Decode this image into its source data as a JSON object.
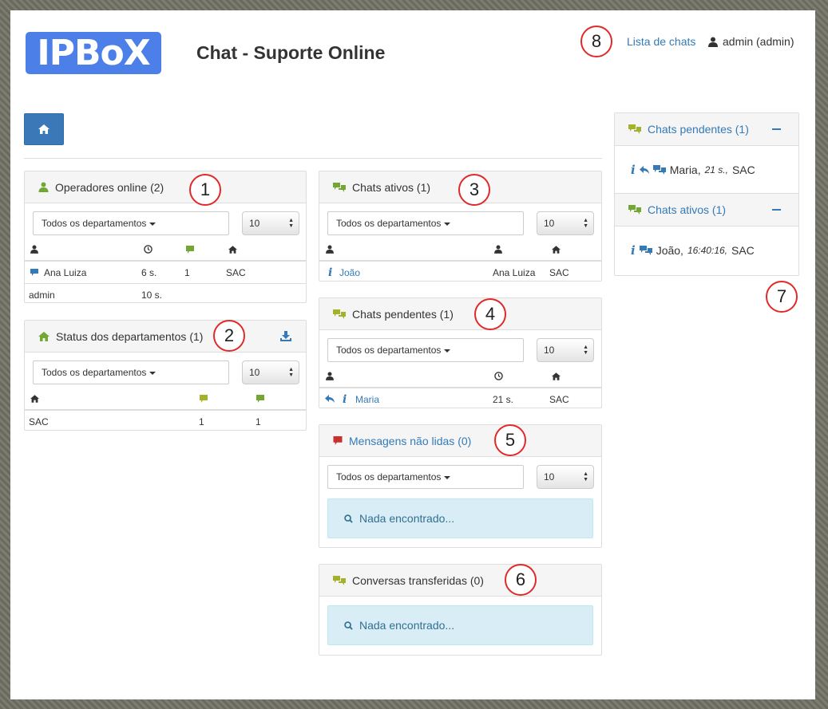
{
  "header": {
    "logo": "IPBoX",
    "title": "Chat - Suporte Online",
    "chat_list_link": "Lista de chats",
    "user": "admin (admin)"
  },
  "callouts": [
    "1",
    "2",
    "3",
    "4",
    "5",
    "6",
    "7",
    "8"
  ],
  "filter": {
    "department": "Todos os departamentos",
    "page_size": "10"
  },
  "online_operators": {
    "title": "Operadores online (2)",
    "rows": [
      {
        "name": "Ana Luiza",
        "time": "6 s.",
        "chats": "1",
        "dept": "SAC"
      },
      {
        "name": "admin",
        "time": "10 s.",
        "chats": "",
        "dept": ""
      }
    ]
  },
  "dept_status": {
    "title": "Status dos departamentos (1)",
    "rows": [
      {
        "dept": "SAC",
        "a": "1",
        "b": "1"
      }
    ]
  },
  "active_chats": {
    "title": "Chats ativos (1)",
    "rows": [
      {
        "visitor": "João",
        "operator": "Ana Luiza",
        "dept": "SAC"
      }
    ]
  },
  "pending_chats": {
    "title": "Chats pendentes (1)",
    "rows": [
      {
        "visitor": "Maria",
        "time": "21 s.",
        "dept": "SAC"
      }
    ]
  },
  "unread_messages": {
    "title": "Mensagens não lidas (0)",
    "empty": "Nada encontrado..."
  },
  "transferred": {
    "title": "Conversas transferidas (0)",
    "empty": "Nada encontrado..."
  },
  "sidebar": {
    "pending_title": "Chats pendentes (1)",
    "pending_item": {
      "name": "Maria,",
      "time": "21 s.,",
      "dept": "SAC"
    },
    "active_title": "Chats ativos (1)",
    "active_item": {
      "name": "João,",
      "time": "16:40:16,",
      "dept": "SAC"
    }
  },
  "colors": {
    "primary": "#337ab7",
    "green": "#72a733",
    "red": "#c9302c",
    "info_bg": "#d9edf7"
  }
}
